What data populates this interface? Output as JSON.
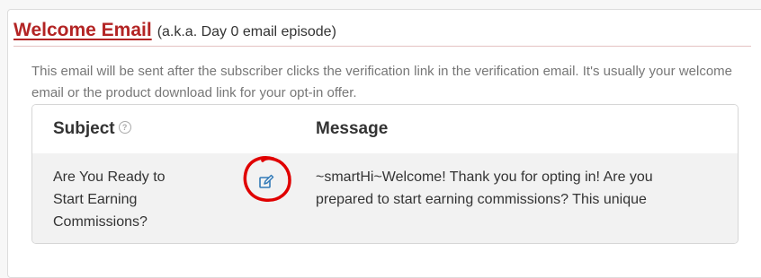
{
  "section": {
    "title": "Welcome Email",
    "title_note": "(a.k.a. Day 0 email episode)",
    "description": "This email will be sent after the subscriber clicks the verification link in the verification email. It's usually your welcome email or the product download link for your opt-in offer."
  },
  "table": {
    "headers": {
      "subject": "Subject",
      "message": "Message"
    },
    "help_icon": "question-circle-icon",
    "rows": [
      {
        "subject": "Are You Ready to Start Earning Commissions?",
        "message": "~smartHi~Welcome! Thank you for opting in! Are you prepared to start earning commissions? This unique",
        "action_icon": "edit-icon"
      }
    ]
  },
  "colors": {
    "title": "#b32424",
    "annotation_circle": "#e00000",
    "edit_icon": "#337ab7",
    "row_background": "#f2f2f2"
  }
}
